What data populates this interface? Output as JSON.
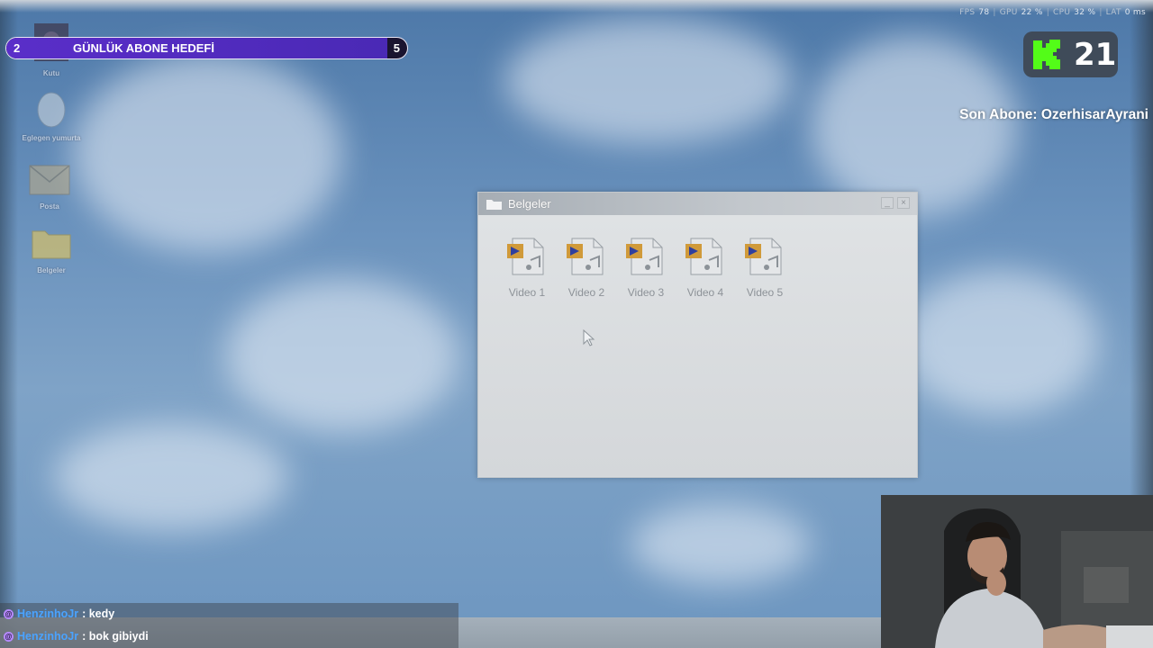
{
  "perf": {
    "fps_label": "FPS",
    "fps_value": "78",
    "gpu_label": "GPU",
    "gpu_value": "22 %",
    "cpu_label": "CPU",
    "cpu_value": "32 %",
    "lat_label": "LAT",
    "lat_value": "0 ms"
  },
  "goal": {
    "current": "2",
    "title": "GÜNLÜK ABONE HEDEFİ",
    "target": "5",
    "progress_fraction": 0.4
  },
  "kick": {
    "count": "21",
    "brand_color": "#53fc18"
  },
  "last_subscriber": "Son Abone: OzerhisarAyrani",
  "desktop_icons": [
    {
      "label": "Kutu",
      "icon": "photo-icon"
    },
    {
      "label": "Eglegen yumurta",
      "icon": "egg-icon"
    },
    {
      "label": "Posta",
      "icon": "mail-icon"
    },
    {
      "label": "Belgeler",
      "icon": "folder-icon"
    }
  ],
  "window": {
    "title": "Belgeler",
    "files": [
      {
        "name": "Video 1",
        "icon": "video-file-icon"
      },
      {
        "name": "Video 2",
        "icon": "video-file-icon"
      },
      {
        "name": "Video 3",
        "icon": "video-file-icon"
      },
      {
        "name": "Video 4",
        "icon": "video-file-icon"
      },
      {
        "name": "Video 5",
        "icon": "video-file-icon"
      }
    ]
  },
  "chat": [
    {
      "user": "HenzinhoJr",
      "message": ": kedy"
    },
    {
      "user": "HenzinhoJr",
      "message": ": bok gibiydi"
    }
  ]
}
